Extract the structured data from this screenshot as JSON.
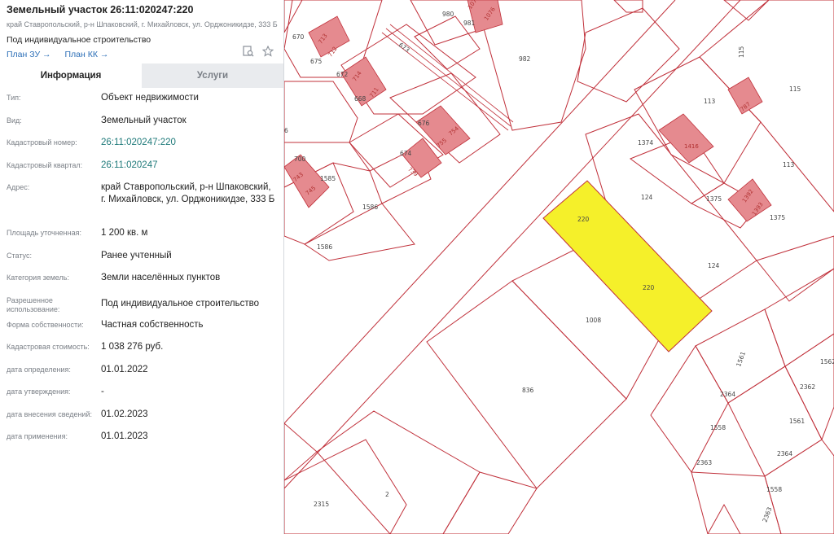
{
  "header": {
    "title": "Земельный участок 26:11:020247:220",
    "address": "край Ставропольский, р-н Шпаковский, г. Михайловск, ул. Орджоникидзе, 333 Б",
    "purpose": "Под индивидуальное строительство",
    "link_plan_zu": "План ЗУ →",
    "link_plan_kk": "План КК →"
  },
  "tabs": {
    "info": "Информация",
    "services": "Услуги"
  },
  "fields": [
    {
      "label": "Тип:",
      "value": "Объект недвижимости"
    },
    {
      "label": "Вид:",
      "value": "Земельный участок"
    },
    {
      "label": "Кадастровый номер:",
      "value": "26:11:020247:220"
    },
    {
      "label": "Кадастровый квартал:",
      "value": "26:11:020247"
    },
    {
      "label": "Адрес:",
      "value": "край Ставропольский, р-н Шпаковский, г. Михайловск, ул. Орджоникидзе, 333 Б"
    },
    {
      "label": "Площадь уточненная:",
      "value": "1 200 кв. м"
    },
    {
      "label": "Статус:",
      "value": "Ранее учтенный"
    },
    {
      "label": "Категория земель:",
      "value": "Земли населённых пунктов"
    },
    {
      "label": "Разрешенное использование:",
      "value": "Под индивидуальное строительство"
    },
    {
      "label": "Форма собственности:",
      "value": "Частная собственность"
    },
    {
      "label": "Кадастровая стоимость:",
      "value": "1 038 276 руб."
    },
    {
      "label": "дата определения:",
      "value": "01.01.2022"
    },
    {
      "label": "дата утверждения:",
      "value": "-"
    },
    {
      "label": "дата внесения сведений:",
      "value": "01.02.2023"
    },
    {
      "label": "дата применения:",
      "value": "01.01.2023"
    }
  ],
  "map": {
    "parcel_colors": {
      "highlight": "#f5f02a",
      "building": "#e58a8f",
      "line": "#c0303a"
    },
    "labels": {
      "p220a": "220",
      "p220b": "220",
      "p124a": "124",
      "p124b": "124",
      "p1008": "1008",
      "p836": "836",
      "p113a": "113",
      "p113b": "113",
      "p115a": "115",
      "p115b": "115",
      "p1374": "1374",
      "p1375a": "1375",
      "p1375b": "1375",
      "p982": "982",
      "p980": "980",
      "p981": "981",
      "p673": "673",
      "p670": "670",
      "p675": "675",
      "p672": "672",
      "p668": "668",
      "p676": "676",
      "p674": "674",
      "p700": "700",
      "p1585": "1585",
      "p1586a": "1586",
      "p1586b": "1586",
      "p6": "6",
      "p2315": "2315",
      "p2": "2",
      "p2363": "2363",
      "p2364a": "2364",
      "p2364b": "2364",
      "p1558a": "1558",
      "p1558b": "1558",
      "p1561a": "1561",
      "p1561b": "1561",
      "p2362": "2362",
      "p1562": "1562",
      "p2363b": "2363",
      "b787": "787",
      "b1416": "1416",
      "b1392": "1392",
      "b1393": "1393",
      "b754": "754",
      "b755": "755",
      "b739": "739",
      "b743": "743",
      "b745": "745",
      "b713": "713",
      "b712": "712",
      "b714": "714",
      "b711": "711",
      "b1076": "1076",
      "b1070": "1070"
    }
  }
}
